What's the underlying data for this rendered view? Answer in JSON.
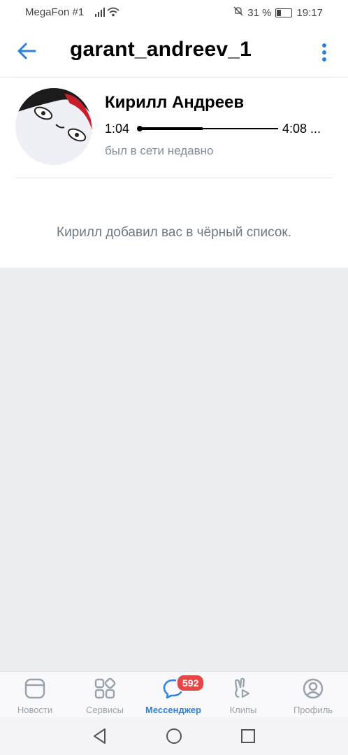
{
  "status_bar": {
    "carrier": "MegaFon #1",
    "battery": "31 %",
    "time": "19:17"
  },
  "header": {
    "title": "garant_andreev_1"
  },
  "profile": {
    "name": "Кирилл Андреев",
    "time_current": "1:04",
    "time_total": "4:08 ...",
    "progress": 0.46,
    "status": "был в сети недавно"
  },
  "message": {
    "text": "Кирилл добавил вас в чёрный список."
  },
  "tabbar": {
    "tabs": [
      {
        "label": "Новости",
        "icon": "news-icon"
      },
      {
        "label": "Сервисы",
        "icon": "services-icon"
      },
      {
        "label": "Мессенджер",
        "icon": "messenger-icon",
        "badge": "592",
        "active": true
      },
      {
        "label": "Клипы",
        "icon": "clips-icon"
      },
      {
        "label": "Профиль",
        "icon": "profile-icon"
      }
    ]
  },
  "colors": {
    "accent": "#2d81e0",
    "badge": "#e64646",
    "muted": "#818c99",
    "background": "#ebedf0"
  }
}
